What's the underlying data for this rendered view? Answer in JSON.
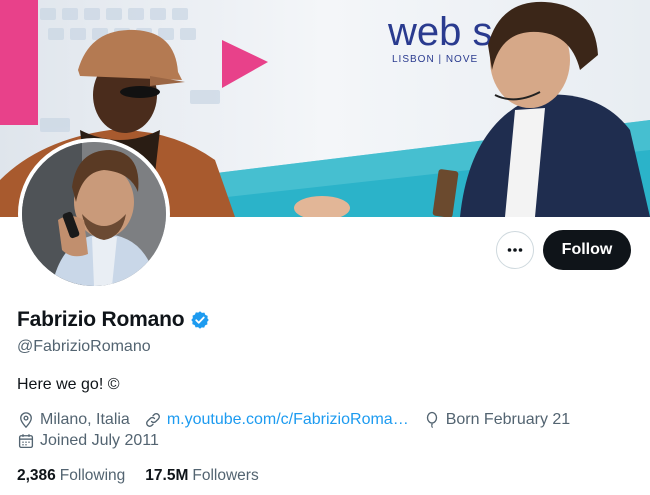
{
  "banner": {
    "sign_text": "web s",
    "sign_subtext": "LISBON | NOVE"
  },
  "profile": {
    "display_name": "Fabrizio Romano",
    "handle": "@FabrizioRomano",
    "bio": "Here we go! ©",
    "verified": true,
    "location": "Milano, Italia",
    "website": "m.youtube.com/c/FabrizioRoma…",
    "birthday": "Born February 21",
    "joined": "Joined July 2011"
  },
  "actions": {
    "more_icon": "more-horizontal-icon",
    "follow_label": "Follow"
  },
  "stats": {
    "following_count": "2,386",
    "following_label": "Following",
    "followers_count": "17.5M",
    "followers_label": "Followers"
  },
  "colors": {
    "accent": "#1d9bf0",
    "text_primary": "#0f1419",
    "text_secondary": "#536471",
    "follow_bg": "#0f1419"
  }
}
